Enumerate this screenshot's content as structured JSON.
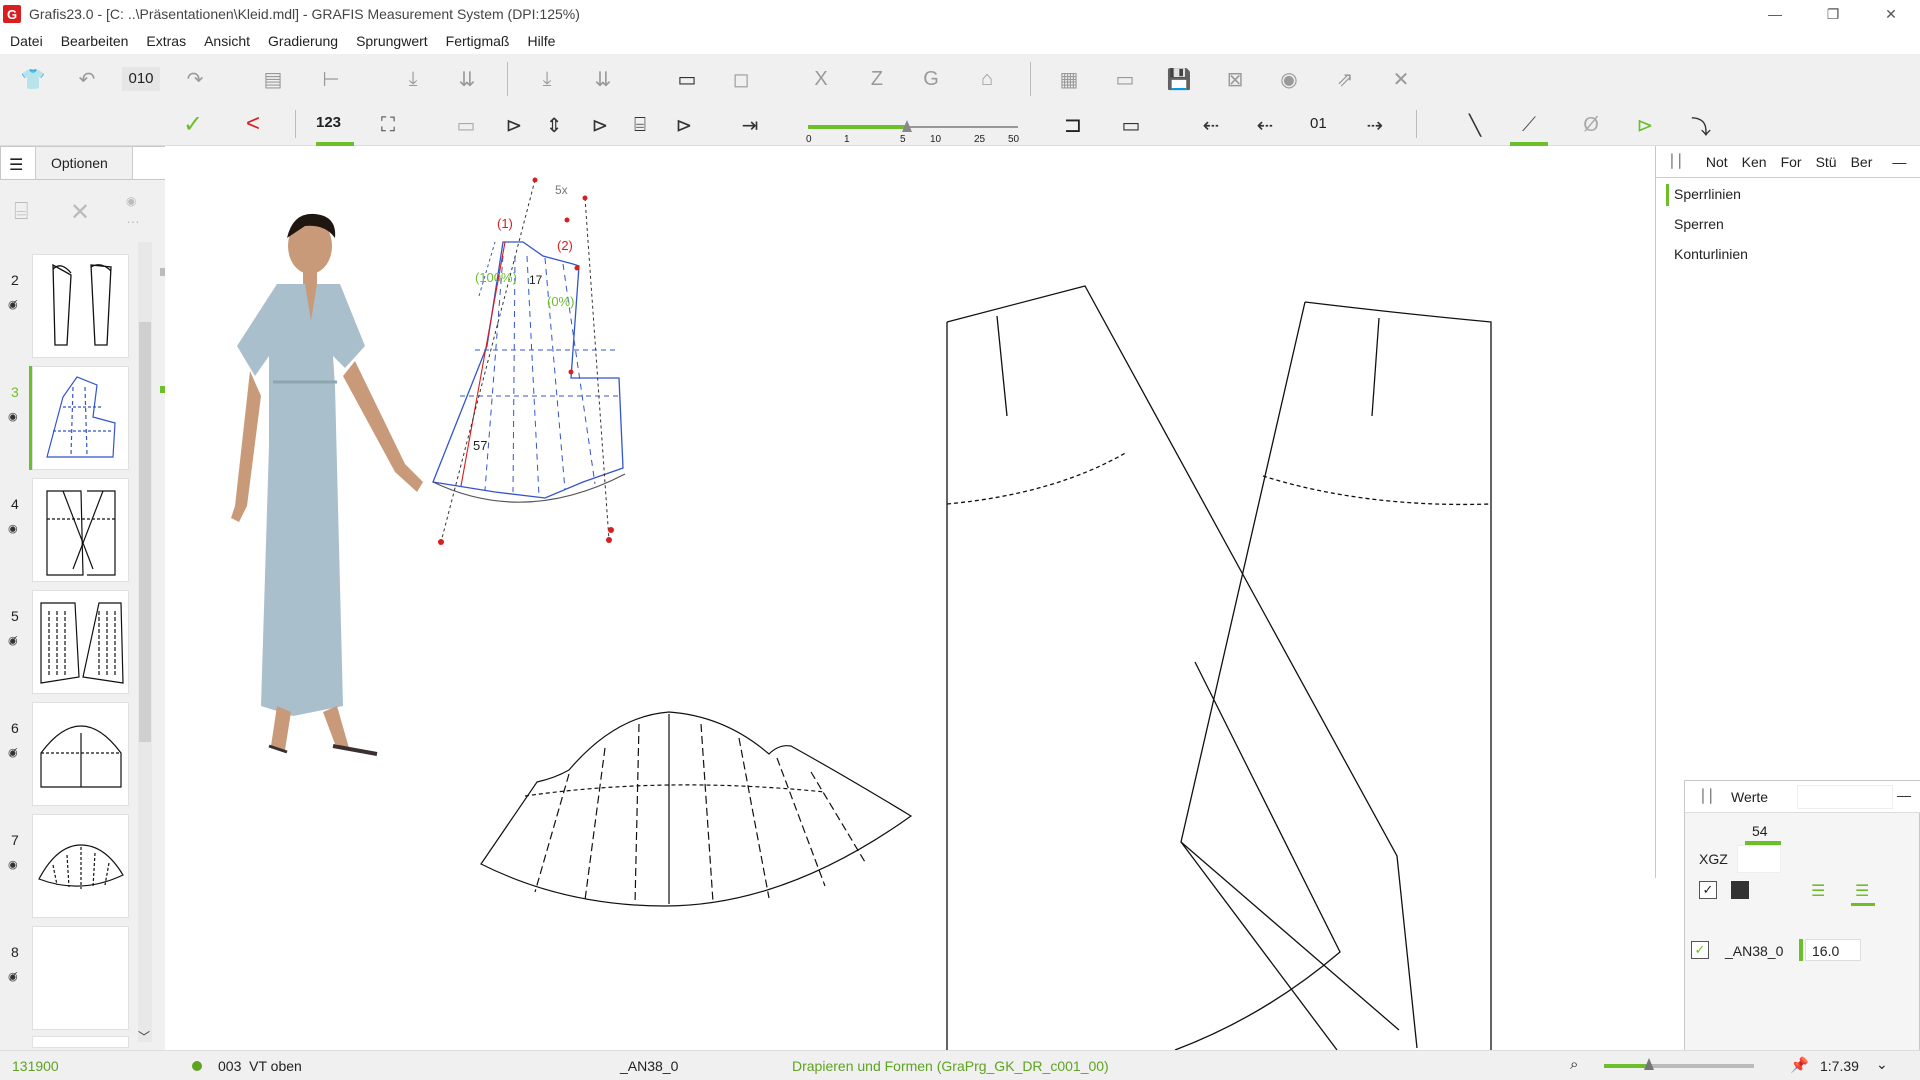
{
  "window": {
    "app_name": "Grafis23.0",
    "title": "[C: ..\\Präsentationen\\Kleid.mdl] - GRAFIS Measurement System   (DPI:125%)"
  },
  "menu": [
    "Datei",
    "Bearbeiten",
    "Extras",
    "Ansicht",
    "Gradierung",
    "Sprungwert",
    "Fertigmaß",
    "Hilfe"
  ],
  "toolbar1": {
    "counter": "010"
  },
  "toolbar2": {
    "counter": "123",
    "slider_ticks": [
      "0",
      "1",
      "5",
      "10",
      "25",
      "50"
    ],
    "step_value": "01"
  },
  "left": {
    "header_label": "Optionen",
    "thumbnails": [
      {
        "num": "2",
        "active": false
      },
      {
        "num": "3",
        "active": true
      },
      {
        "num": "4",
        "active": false
      },
      {
        "num": "5",
        "active": false
      },
      {
        "num": "6",
        "active": false
      },
      {
        "num": "7",
        "active": false
      },
      {
        "num": "8",
        "active": false
      }
    ]
  },
  "canvas": {
    "labels": {
      "l1": "(1)",
      "l2": "(2)",
      "l100": "(100%)",
      "l0": "(0%)",
      "l5x": "5x",
      "l17": "17",
      "l57": "57"
    }
  },
  "right_panel": {
    "tabs": [
      "Not",
      "Ken",
      "For",
      "Stü",
      "Ber"
    ],
    "items": [
      "Sperrlinien",
      "Sperren",
      "Konturlinien"
    ]
  },
  "werte": {
    "title": "Werte",
    "size_value": "54",
    "size_label": "XGZ",
    "row_label": "_AN38_0",
    "row_value": "16.0"
  },
  "status": {
    "code": "131900",
    "part": "003  VT oben",
    "size": "_AN38_0",
    "program": "Drapieren und Formen (GraPrg_GK_DR_c001_00)",
    "scale": "1:7.39"
  },
  "colors": {
    "accent_green": "#6cbf2b",
    "logo_red": "#d81e1e",
    "status_green": "#5fa320"
  }
}
